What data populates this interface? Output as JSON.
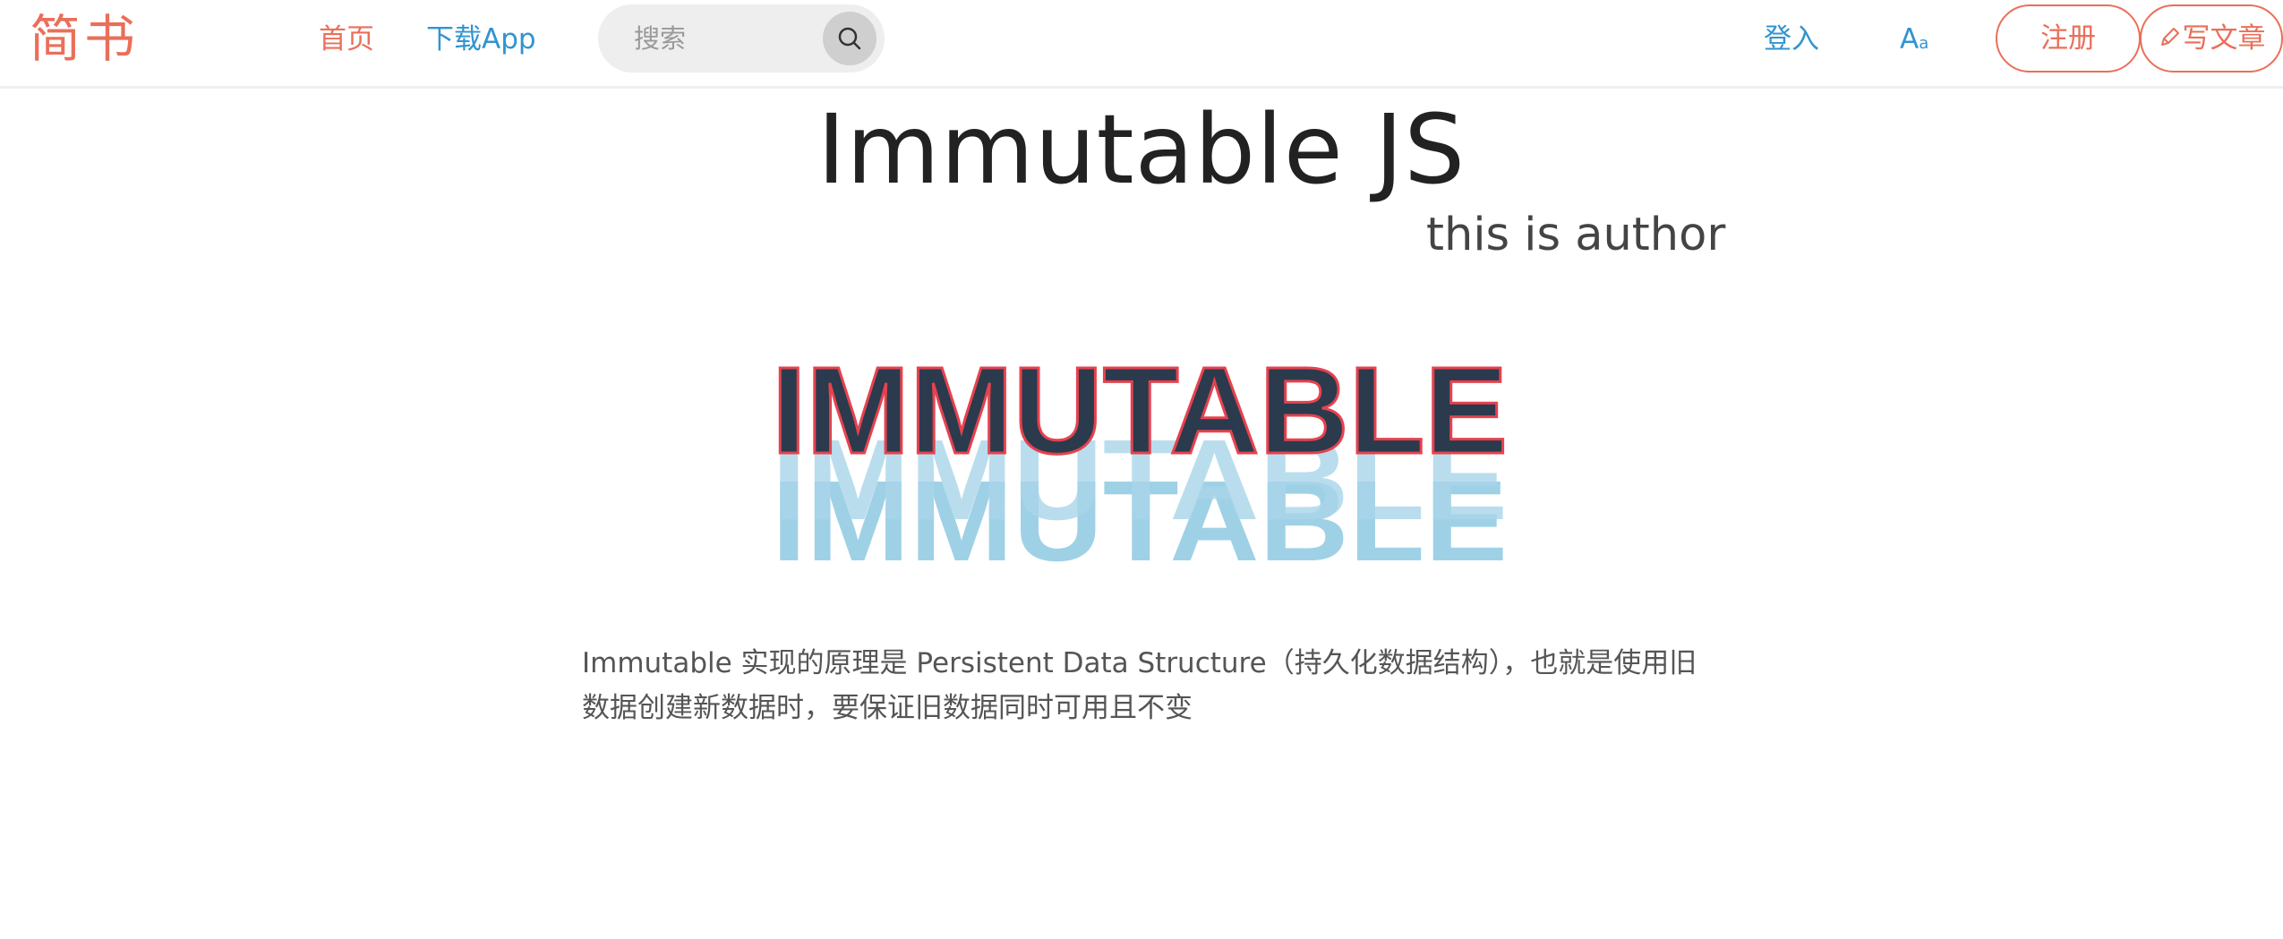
{
  "header": {
    "logo": "简书",
    "nav": {
      "home": "首页",
      "download": "下载App"
    },
    "search": {
      "placeholder": "搜索",
      "icon": "search-icon"
    },
    "login": "登入",
    "font_toggle": {
      "big": "A",
      "small": "a"
    },
    "register": "注册",
    "write": "写文章",
    "write_icon": "pencil-icon"
  },
  "article": {
    "title": "Immutable JS",
    "author": "this is author",
    "image_text": "IMMUTABLE",
    "content": "Immutable 实现的原理是 Persistent Data Structure（持久化数据结构），也就是使用旧数据创建新数据时，要保证旧数据同时可用且不变"
  },
  "colors": {
    "brand": "#ea6f5a",
    "link": "#3194d0",
    "title": "#222222",
    "image_dark": "#2b3a4d",
    "image_red": "#e6424e",
    "image_light": "#8fc9e2"
  }
}
